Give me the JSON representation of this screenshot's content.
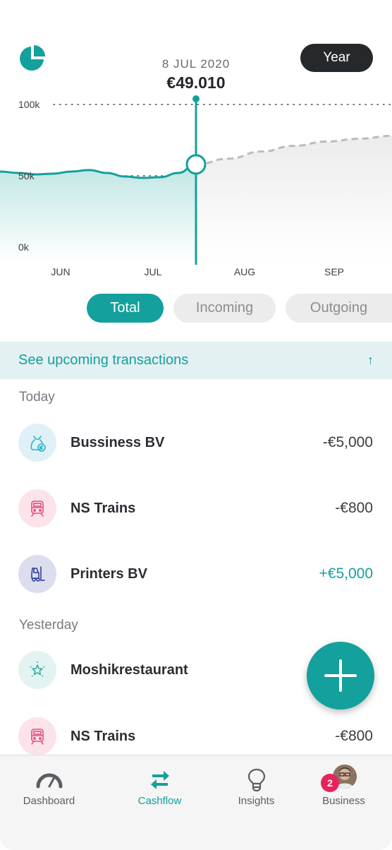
{
  "header": {
    "tooltip_date": "8 JUL 2020",
    "tooltip_value": "€49.010",
    "period_button": "Year"
  },
  "chart_data": {
    "type": "area",
    "y_ticks": [
      "100k",
      "50k",
      "0k"
    ],
    "x_ticks": [
      "JUN",
      "JUL",
      "AUG",
      "SEP"
    ],
    "ylim": [
      0,
      100000
    ],
    "selected_point": {
      "date": "8 JUL 2020",
      "value": 49010
    },
    "series": [
      {
        "values": [
          53000,
          52000,
          51000,
          51500,
          53000,
          54000,
          52000,
          49500,
          48500,
          49000,
          52000,
          58000
        ]
      }
    ],
    "projection": {
      "values": [
        62000,
        67000,
        71000,
        74000,
        76000,
        78000
      ]
    },
    "accent": "#14a09c"
  },
  "filters": {
    "total": "Total",
    "incoming": "Incoming",
    "outgoing": "Outgoing"
  },
  "upcoming": {
    "label": "See upcoming transactions",
    "arrow": "↑"
  },
  "sections": {
    "today": "Today",
    "yesterday": "Yesterday"
  },
  "transactions": [
    {
      "name": "Bussiness BV",
      "amount": "-€5,000",
      "icon": "money-bag-icon"
    },
    {
      "name": "NS Trains",
      "amount": "-€800",
      "icon": "train-icon"
    },
    {
      "name": "Printers BV",
      "amount": "+€5,000",
      "icon": "forklift-icon"
    },
    {
      "name": "Moshikrestaurant",
      "amount": "",
      "icon": "star-icon"
    },
    {
      "name": "NS Trains",
      "amount": "-€800",
      "icon": "train-icon"
    }
  ],
  "nav": {
    "dashboard": "Dashboard",
    "cashflow": "Cashflow",
    "insights": "Insights",
    "business": "Business",
    "badge": "2"
  }
}
